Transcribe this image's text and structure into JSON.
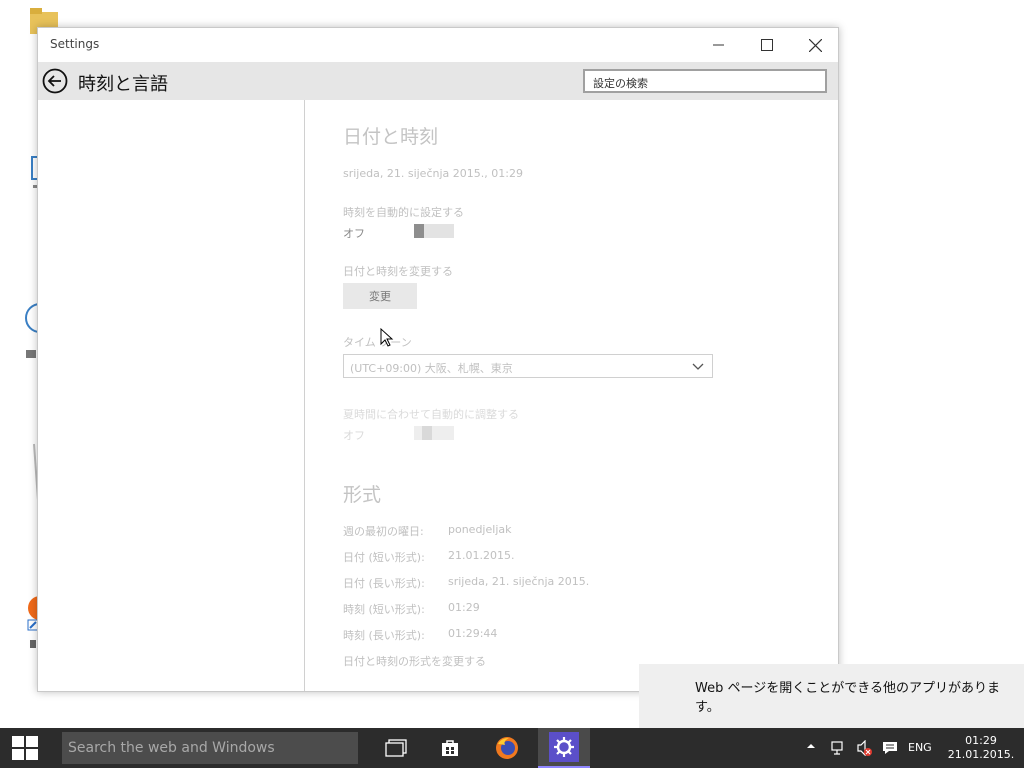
{
  "window": {
    "title": "Settings",
    "header_title": "時刻と言語",
    "search_placeholder": "設定の検索"
  },
  "datetime": {
    "heading": "日付と時刻",
    "current": "srijeda, 21. siječnja 2015., 01:29",
    "auto_time_label": "時刻を自動的に設定する",
    "auto_time_state": "オフ",
    "change_label": "日付と時刻を変更する",
    "change_button": "変更",
    "timezone_label": "タイム ゾーン",
    "timezone_value": "(UTC+09:00) 大阪、札幌、東京",
    "dst_label": "夏時間に合わせて自動的に調整する",
    "dst_state": "オフ"
  },
  "format": {
    "heading": "形式",
    "rows": [
      {
        "label": "週の最初の曜日:",
        "value": "ponedjeljak"
      },
      {
        "label": "日付 (短い形式):",
        "value": "21.01.2015."
      },
      {
        "label": "日付 (長い形式):",
        "value": "srijeda, 21. siječnja 2015."
      },
      {
        "label": "時刻 (短い形式):",
        "value": "01:29"
      },
      {
        "label": "時刻 (長い形式):",
        "value": "01:29:44"
      }
    ],
    "change_link": "日付と時刻の形式を変更する"
  },
  "notification": {
    "text": "Web ページを開くことができる他のアプリがあります。"
  },
  "taskbar": {
    "search_placeholder": "Search the web and Windows",
    "language": "ENG",
    "time": "01:29",
    "date": "21.01.2015."
  },
  "colors": {
    "accent": "#5b4fc9",
    "taskbar": "#2c2c2c"
  }
}
